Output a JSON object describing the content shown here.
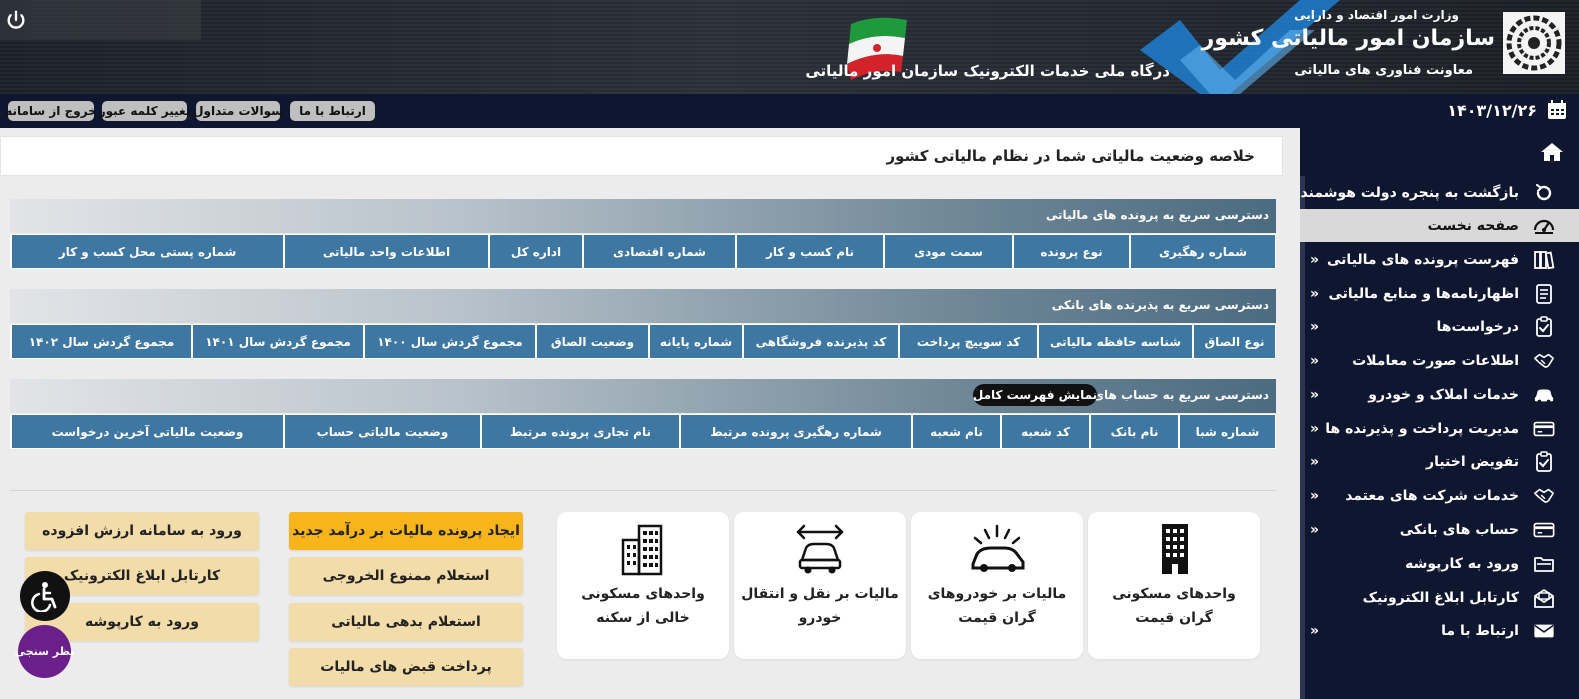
{
  "header": {
    "ministry": "وزارت امور اقتصاد و دارایی",
    "org_name": "سازمان امور مالیاتی کشور",
    "deputy": "معاونت فناوری های مالیاتی",
    "portal_title": "درگاه ملی خدمات الکترونیک سازمان امور مالیاتی"
  },
  "topbar": {
    "date": "۱۴۰۳/۱۲/۲۶",
    "buttons": [
      "ارتباط با ما",
      "سوالات متداول",
      "تغییر کلمه عبور",
      "خروج از سامانه"
    ]
  },
  "sidebar": {
    "items": [
      {
        "label": "بازگشت به پنجره دولت هوشمند",
        "icon": "return-icon",
        "chevron": false
      },
      {
        "label": "صفحه نخست",
        "icon": "dashboard-icon",
        "chevron": false,
        "active": true
      },
      {
        "label": "فهرست پرونده های مالیاتی",
        "icon": "books-icon",
        "chevron": true
      },
      {
        "label": "اظهارنامه‌ها و منابع مالیاتی",
        "icon": "document-icon",
        "chevron": true
      },
      {
        "label": "درخواست‌ها",
        "icon": "clipboard-check-icon",
        "chevron": true
      },
      {
        "label": "اطلاعات صورت معاملات",
        "icon": "handshake-icon",
        "chevron": true
      },
      {
        "label": "خدمات املاک و خودرو",
        "icon": "car-icon",
        "chevron": true
      },
      {
        "label": "مدیریت پرداخت و پذیرنده ها",
        "icon": "credit-card-icon",
        "chevron": true
      },
      {
        "label": "تفویض اختیار",
        "icon": "clipboard-check-icon",
        "chevron": true
      },
      {
        "label": "خدمات شرکت های معتمد",
        "icon": "handshake-icon",
        "chevron": true
      },
      {
        "label": "حساب های بانکی",
        "icon": "credit-card-icon",
        "chevron": true
      },
      {
        "label": "ورود به کارپوشه",
        "icon": "folder-icon",
        "chevron": false
      },
      {
        "label": "کارتابل ابلاغ الکترونیک",
        "icon": "envelope-open-icon",
        "chevron": false
      },
      {
        "label": "ارتباط با ما",
        "icon": "envelope-icon",
        "chevron": true
      }
    ]
  },
  "main": {
    "title": "خلاصه وضعیت مالیاتی شما در نظام مالیاتی کشور",
    "sections": [
      {
        "title": "دسترسی سریع به پرونده های مالیاتی",
        "columns": [
          "شماره رهگیری",
          "نوع پرونده",
          "سمت مودی",
          "نام کسب و کار",
          "شماره اقتصادی",
          "اداره کل",
          "اطلاعات واحد مالیاتی",
          "شماره پستی محل کسب و کار"
        ]
      },
      {
        "title": "دسترسی سریع به پذیرنده های بانکی",
        "columns": [
          "نوع الصاق",
          "شناسه حافظه مالیاتی",
          "کد سوییچ پرداخت",
          "کد پذیرنده فروشگاهی",
          "شماره پایانه",
          "وضعیت الصاق",
          "مجموع گردش سال ۱۴۰۰",
          "مجموع گردش سال ۱۴۰۱",
          "مجموع گردش سال ۱۴۰۲"
        ]
      },
      {
        "title": "دسترسی سریع به حساب های بانکی",
        "show_full_label": "نمایش فهرست کامل",
        "columns": [
          "شماره شبا",
          "نام بانک",
          "کد شعبه",
          "نام شعبه",
          "شماره رهگیری پرونده مرتبط",
          "نام تجاری پرونده مرتبط",
          "وضعیت مالیاتی حساب",
          "وضعیت مالیاتی آخرین درخواست"
        ]
      }
    ],
    "cards": [
      {
        "line1": "واحدهای مسکونی",
        "line2": "گران قیمت",
        "icon": "building-icon"
      },
      {
        "line1": "مالیات بر خودروهای",
        "line2": "گران قیمت",
        "icon": "luxury-car-icon"
      },
      {
        "line1": "مالیات بر نقل و انتقال",
        "line2": "خودرو",
        "icon": "car-transfer-icon"
      },
      {
        "line1": "واحدهای مسکونی",
        "line2": "خالی از سکنه",
        "icon": "apartment-icon"
      }
    ],
    "actions_col1": [
      "ایجاد پرونده مالیات بر درآمد جدید",
      "استعلام ممنوع الخروجی",
      "استعلام بدهی مالیاتی",
      "پرداخت قبض های مالیات"
    ],
    "actions_col2": [
      "ورود به سامانه ارزش افزوده",
      "کارتابل ابلاغ الکترونیک",
      "ورود به کارپوشه"
    ],
    "survey_label": "نظر سنجی"
  },
  "colors": {
    "header_bg": "#1b1f28",
    "navy": "#0f1730",
    "table_blue": "#3e77a1",
    "primary_button": "#f7b41b",
    "secondary_button": "#f1dcaa",
    "survey": "#6a1f8a"
  }
}
